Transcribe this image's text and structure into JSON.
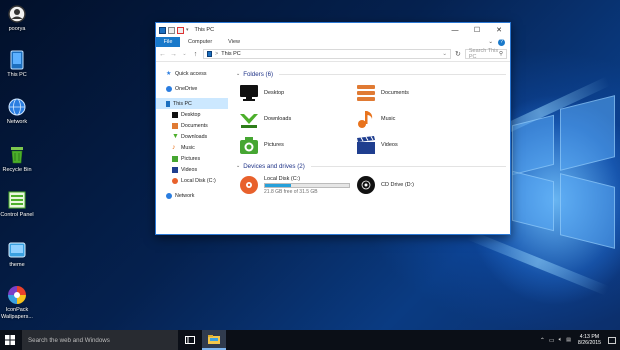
{
  "desktop": {
    "icons": [
      {
        "label": "poorya",
        "icon": "user-folder-icon"
      },
      {
        "label": "This PC",
        "icon": "this-pc-icon"
      },
      {
        "label": "Network",
        "icon": "network-icon"
      },
      {
        "label": "Recycle Bin",
        "icon": "recycle-bin-icon"
      },
      {
        "label": "Control Panel",
        "icon": "control-panel-icon"
      },
      {
        "label": "theme",
        "icon": "theme-icon"
      },
      {
        "label": "IconPack Wallpapers...",
        "icon": "iconpack-icon"
      }
    ]
  },
  "window": {
    "title": "This PC",
    "ribbon_tabs": {
      "file": "File",
      "computer": "Computer",
      "view": "View"
    },
    "address": {
      "path": "This PC",
      "separator": ">"
    },
    "search": {
      "placeholder": "Search This PC"
    },
    "nav_pane": {
      "quick_access": "Quick access",
      "onedrive": "OneDrive",
      "this_pc": "This PC",
      "children": [
        {
          "label": "Desktop",
          "color": "#111111"
        },
        {
          "label": "Documents",
          "color": "#e07a33"
        },
        {
          "label": "Downloads",
          "color": "#4caf2b"
        },
        {
          "label": "Music",
          "color": "#e8731d"
        },
        {
          "label": "Pictures",
          "color": "#46a632"
        },
        {
          "label": "Videos",
          "color": "#1f3e8f"
        },
        {
          "label": "Local Disk (C:)",
          "color": "#e8612c"
        }
      ],
      "network": "Network"
    },
    "folders": {
      "heading": "Folders (6)",
      "items": [
        {
          "label": "Desktop",
          "icon": "desktop-folder-icon"
        },
        {
          "label": "Documents",
          "icon": "documents-folder-icon"
        },
        {
          "label": "Downloads",
          "icon": "downloads-folder-icon"
        },
        {
          "label": "Music",
          "icon": "music-folder-icon"
        },
        {
          "label": "Pictures",
          "icon": "pictures-folder-icon"
        },
        {
          "label": "Videos",
          "icon": "videos-folder-icon"
        }
      ]
    },
    "drives": {
      "heading": "Devices and drives (2)",
      "local_disk": {
        "label": "Local Disk (C:)",
        "free": "21.8 GB free of 31.5 GB",
        "used_fraction": 0.31
      },
      "cd_drive": {
        "label": "CD Drive (D:)"
      }
    }
  },
  "taskbar": {
    "search_placeholder": "Search the web and Windows",
    "time": "4:13 PM",
    "date": "8/26/2015"
  },
  "colors": {
    "accent": "#1979ca",
    "selection": "#cce8ff",
    "heading": "#1e3287",
    "drive_fill": "#26a0da"
  }
}
